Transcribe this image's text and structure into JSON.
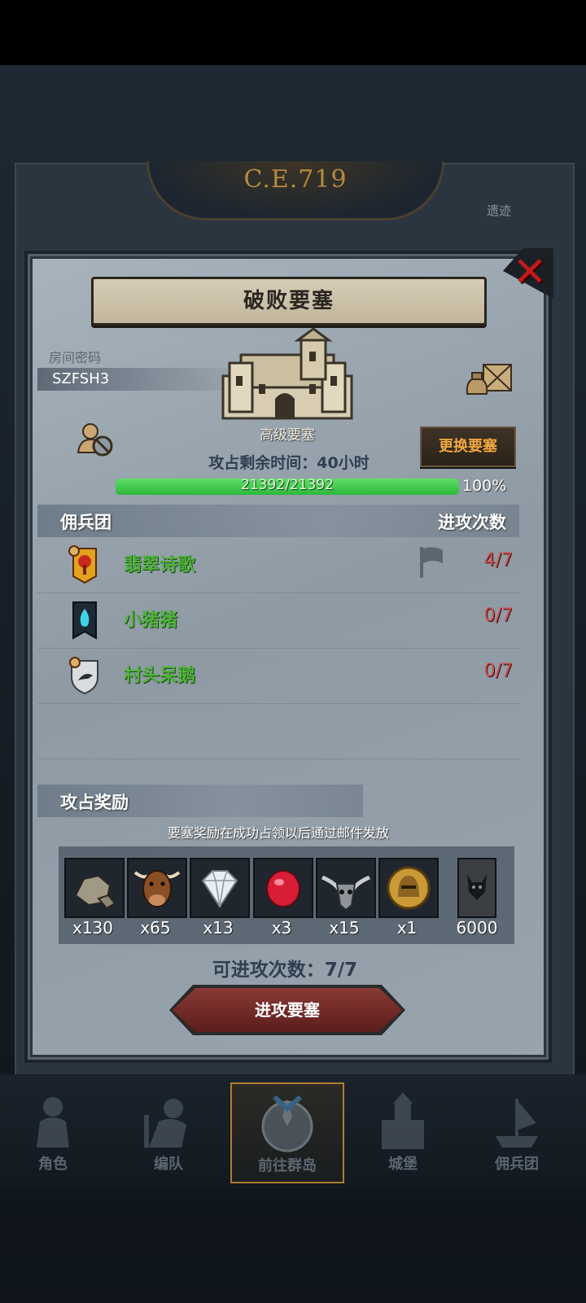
{
  "background": {
    "era_label": "C.E.719",
    "ghost_label": "遗迹"
  },
  "modal": {
    "title": "破败要塞",
    "room_label": "房间密码",
    "room_code": "SZFSH3",
    "fortress_grade": "高级要塞",
    "change_button": "更换要塞",
    "time_remaining": "攻占剩余时间：40小时",
    "hp_text": "21392/21392",
    "hp_percent_label": "100%",
    "hp_fraction": 1.0,
    "mercenary_header": "佣兵团",
    "attack_count_header": "进攻次数",
    "groups": [
      {
        "name": "翡翠诗歌",
        "count": "4/7",
        "emblem": "red-tree-banner-icon",
        "flag": true
      },
      {
        "name": "小猪猪",
        "count": "0/7",
        "emblem": "blue-flame-banner-icon",
        "flag": false
      },
      {
        "name": "村头呆鹅",
        "count": "0/7",
        "emblem": "goose-shield-icon",
        "flag": false
      }
    ],
    "reward_header": "攻占奖励",
    "reward_note": "要塞奖励在成功占领以后通过邮件发放",
    "rewards": [
      {
        "icon": "stone-ore-icon",
        "qty": "x130"
      },
      {
        "icon": "ox-head-icon",
        "qty": "x65"
      },
      {
        "icon": "diamond-icon",
        "qty": "x13"
      },
      {
        "icon": "ruby-icon",
        "qty": "x3"
      },
      {
        "icon": "horned-skull-icon",
        "qty": "x15"
      },
      {
        "icon": "golden-helmet-coin-icon",
        "qty": "x1"
      },
      {
        "icon": "dark-beast-card-icon",
        "qty": "6000"
      }
    ],
    "attacks_available": "可进攻次数：7/7",
    "attack_button": "进攻要塞"
  },
  "nav": [
    {
      "label": "角色",
      "icon": "knight-icon",
      "active": false
    },
    {
      "label": "编队",
      "icon": "formation-icon",
      "active": false
    },
    {
      "label": "前往群岛",
      "icon": "compass-map-icon",
      "active": true
    },
    {
      "label": "城堡",
      "icon": "castle-icon",
      "active": false
    },
    {
      "label": "佣兵团",
      "icon": "mercenary-ship-icon",
      "active": false
    }
  ],
  "colors": {
    "accent_orange": "#f0a83c",
    "group_name_green": "#4fb43d",
    "count_red": "#d14a4a",
    "close_red": "#c4191a",
    "hp_green": "#2cb83a"
  }
}
